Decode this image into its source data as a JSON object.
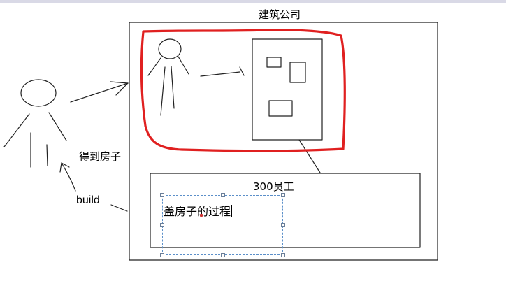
{
  "labels": {
    "company": "建筑公司",
    "get_house": "得到房子",
    "build": "build",
    "staff": "300员工",
    "process": "盖房子的过程"
  },
  "colors": {
    "highlight": "#e02020",
    "selection_border": "#5b8fc9",
    "stroke": "#222222"
  }
}
